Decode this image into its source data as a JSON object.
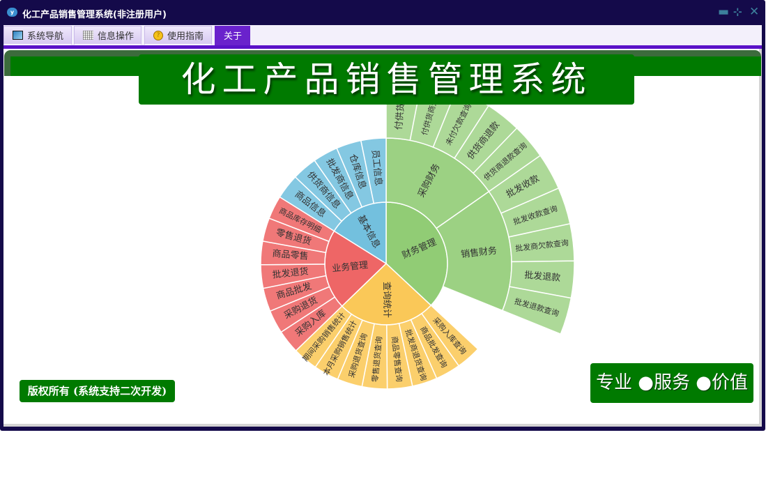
{
  "window": {
    "title": "化工产品销售管理系统(非注册用户)",
    "controls": [
      "minimize",
      "restore",
      "close"
    ]
  },
  "tabs": [
    {
      "label": "系统导航",
      "icon": "monitor-icon"
    },
    {
      "label": "信息操作",
      "icon": "grid-icon"
    },
    {
      "label": "使用指南",
      "icon": "help-icon"
    },
    {
      "label": "关于",
      "active": true
    }
  ],
  "banner": {
    "title": "化工产品销售管理系统"
  },
  "footer": {
    "copyright": "版权所有 (系统支持二次开发)",
    "slogan": "专业 ●服务 ●价值"
  },
  "colors": {
    "frame": "#140a4a",
    "accent": "#5a12c8",
    "banner": "#007a00"
  },
  "chart_data": {
    "type": "sunburst",
    "groups": [
      {
        "name": "财务管理",
        "color": "#91cc75",
        "children": [
          {
            "name": "采购财务",
            "children": [
              "付供货商款",
              "付供货商欠款",
              "未付欠款查询",
              "供货商退款",
              "供货商退款查询"
            ]
          },
          {
            "name": "销售财务",
            "children": [
              "批发收款",
              "批发收款查询",
              "批发商欠款查询",
              "批发退款",
              "批发退款查询"
            ]
          }
        ]
      },
      {
        "name": "查询统计",
        "color": "#fac858",
        "children": [
          "采购入库查询",
          "商品批发查询",
          "批发商退货查询",
          "商品零售查询",
          "零售退货查询",
          "采购退货查询",
          "本月采购销售统计",
          "期间采购销售统计"
        ]
      },
      {
        "name": "业务管理",
        "color": "#ee6666",
        "children": [
          "采购入库",
          "采购退货",
          "商品批发",
          "批发退货",
          "商品零售",
          "零售退货",
          "商品库存明细"
        ]
      },
      {
        "name": "基本信息",
        "color": "#73c0de",
        "children": [
          "商品信息",
          "供货商信息",
          "批发商信息",
          "仓库信息",
          "员工信息"
        ]
      }
    ]
  }
}
